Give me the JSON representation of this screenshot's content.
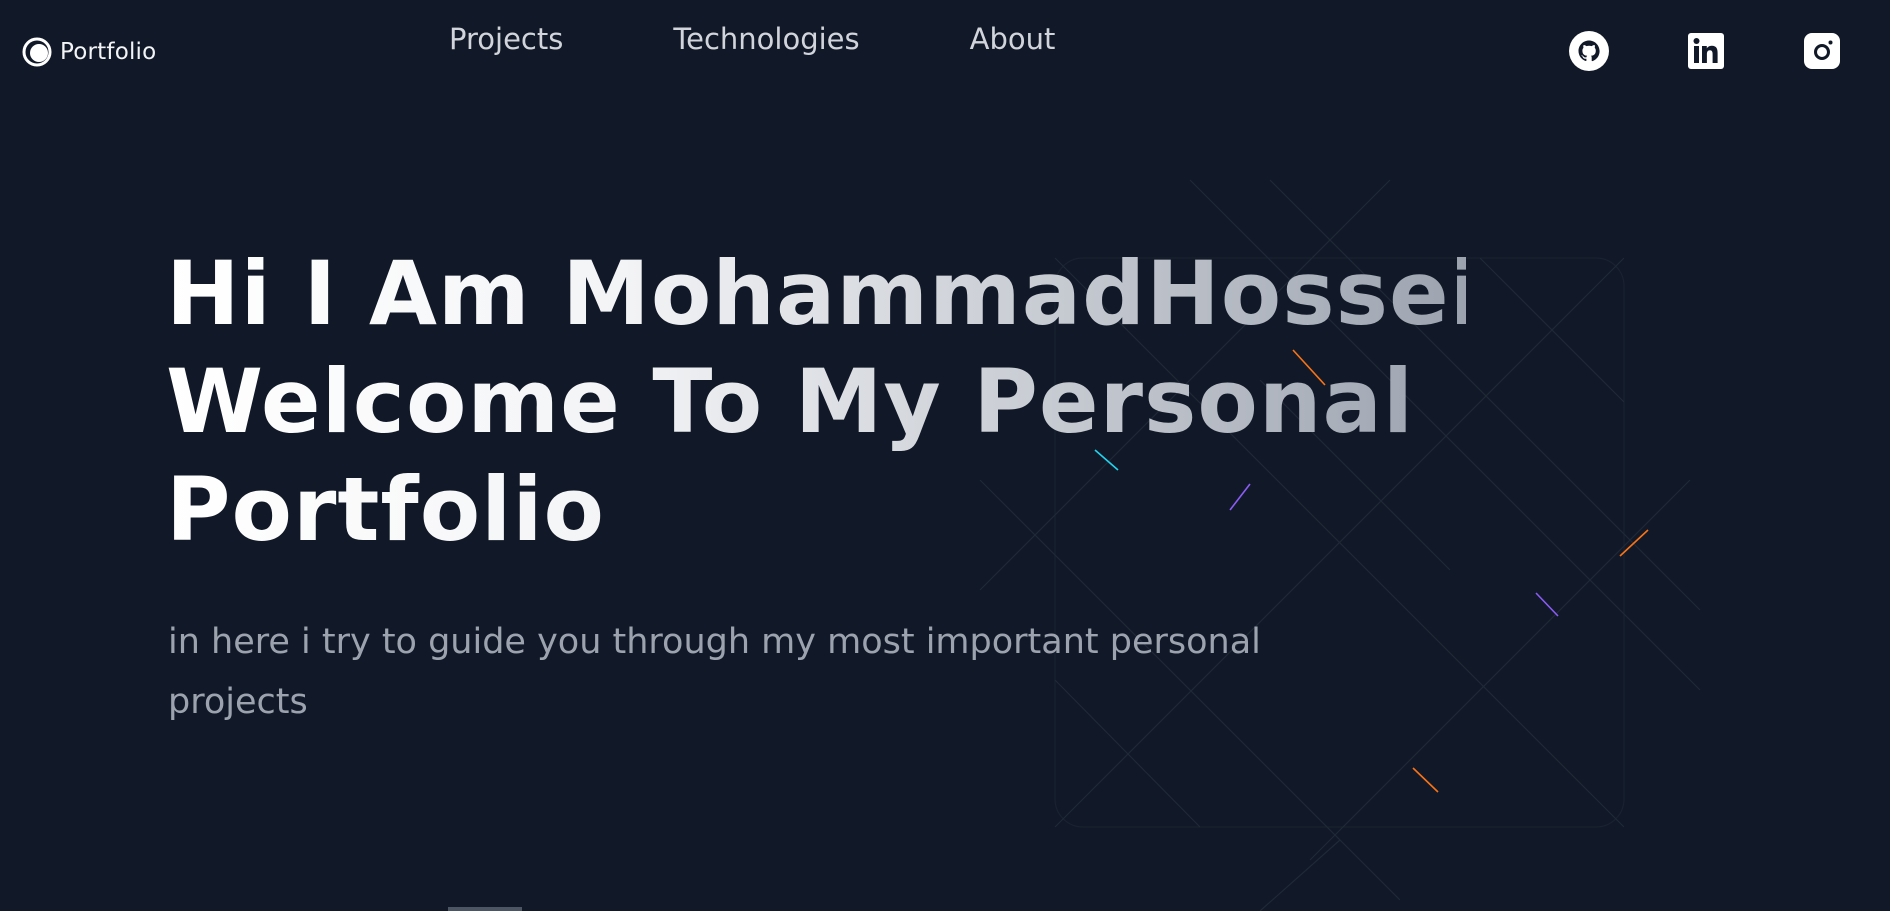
{
  "navbar": {
    "brand_label": "Portfolio",
    "links": [
      {
        "label": "Projects"
      },
      {
        "label": "Technologies"
      },
      {
        "label": "About"
      }
    ],
    "social": [
      {
        "icon": "github-icon"
      },
      {
        "icon": "linkedin-icon"
      },
      {
        "icon": "instagram-icon"
      }
    ]
  },
  "hero": {
    "title_lines": [
      "Hi I Am MohammadHossein",
      "Welcome To My Personal",
      "Portfolio"
    ],
    "subtitle": "in here i try to guide you through my most important personal projects"
  },
  "colors": {
    "background": "#111827",
    "text_primary": "#ffffff",
    "text_secondary": "#9ca3af",
    "nav_text": "#d1d5db"
  }
}
